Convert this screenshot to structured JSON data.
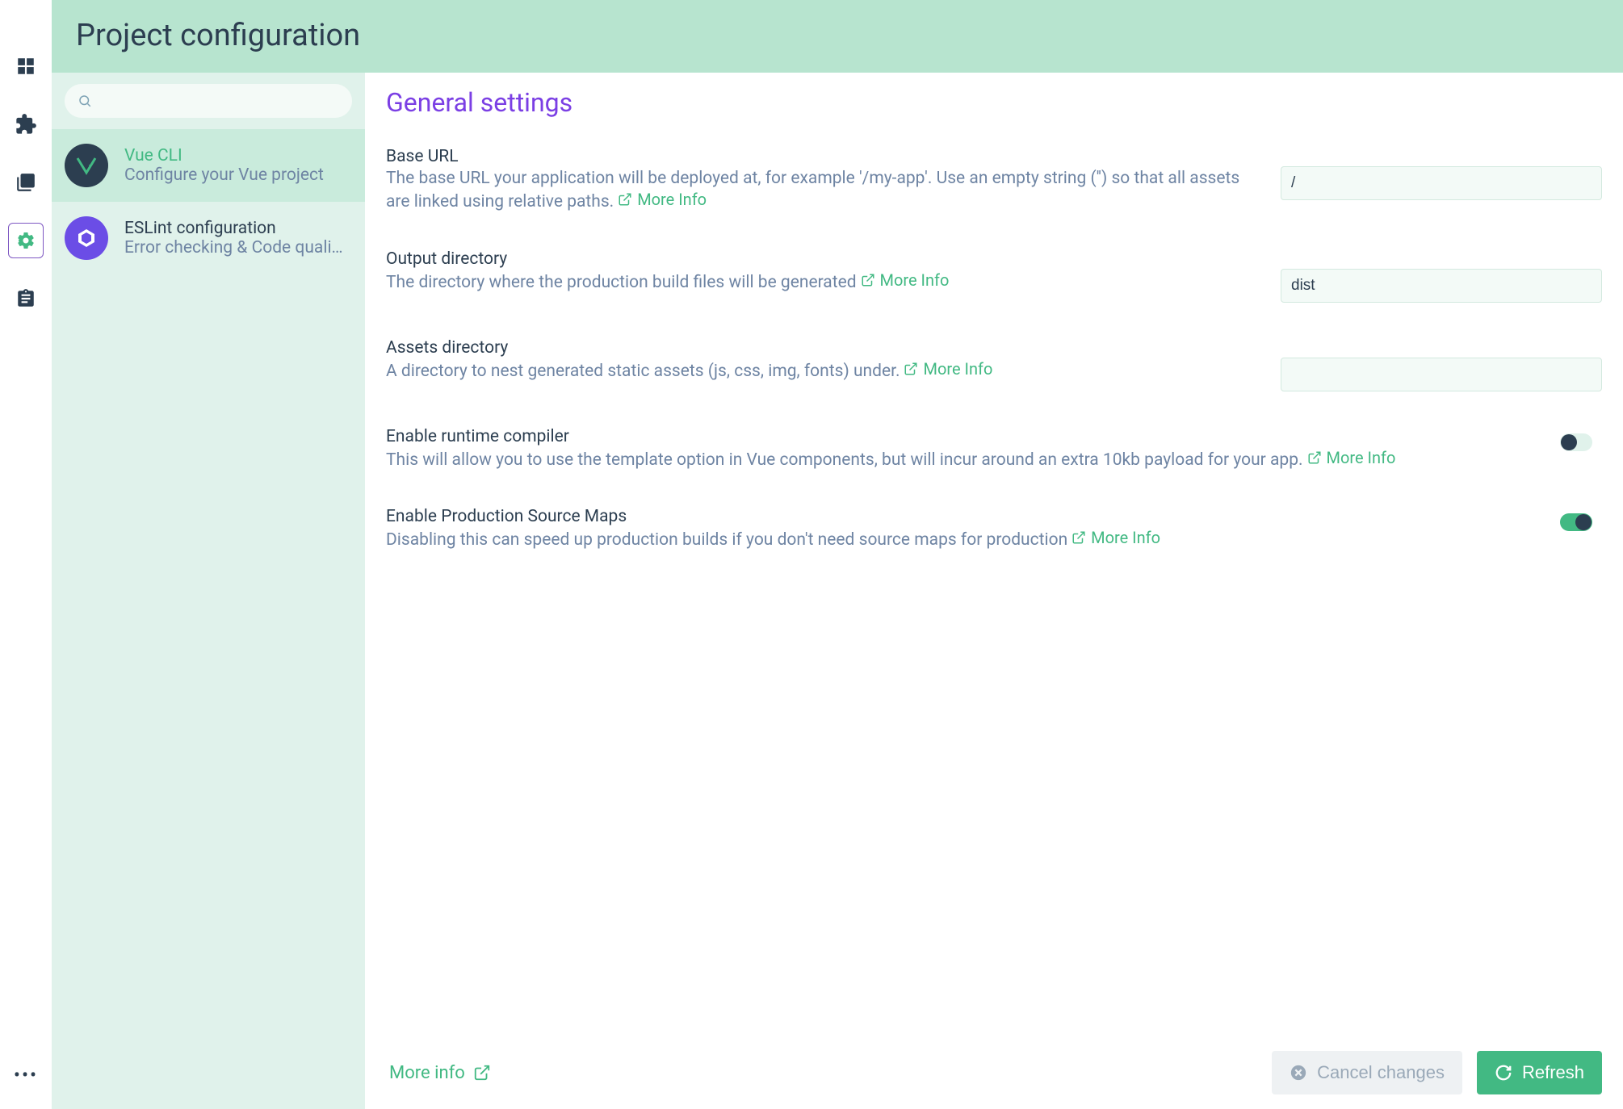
{
  "header": {
    "title": "Project configuration"
  },
  "search": {
    "placeholder": ""
  },
  "sidebar": {
    "items": [
      {
        "title": "Vue CLI",
        "subtitle": "Configure your Vue project",
        "active": true
      },
      {
        "title": "ESLint configuration",
        "subtitle": "Error checking & Code quali…",
        "active": false
      }
    ]
  },
  "panel": {
    "heading": "General settings",
    "more_info_label": "More Info",
    "fields": {
      "base_url": {
        "name": "Base URL",
        "desc": "The base URL your application will be deployed at, for example '/my-app'. Use an empty string ('') so that all assets are linked using relative paths.",
        "value": "/"
      },
      "output_dir": {
        "name": "Output directory",
        "desc": "The directory where the production build files will be generated",
        "value": "dist"
      },
      "assets_dir": {
        "name": "Assets directory",
        "desc": "A directory to nest generated static assets (js, css, img, fonts) under.",
        "value": ""
      },
      "runtime_compiler": {
        "name": "Enable runtime compiler",
        "desc": "This will allow you to use the template option in Vue components, but will incur around an extra 10kb payload for your app.",
        "on": false
      },
      "source_maps": {
        "name": "Enable Production Source Maps",
        "desc": "Disabling this can speed up production builds if you don't need source maps for production",
        "on": true
      }
    }
  },
  "footer": {
    "more_info": "More info",
    "cancel": "Cancel changes",
    "refresh": "Refresh"
  }
}
